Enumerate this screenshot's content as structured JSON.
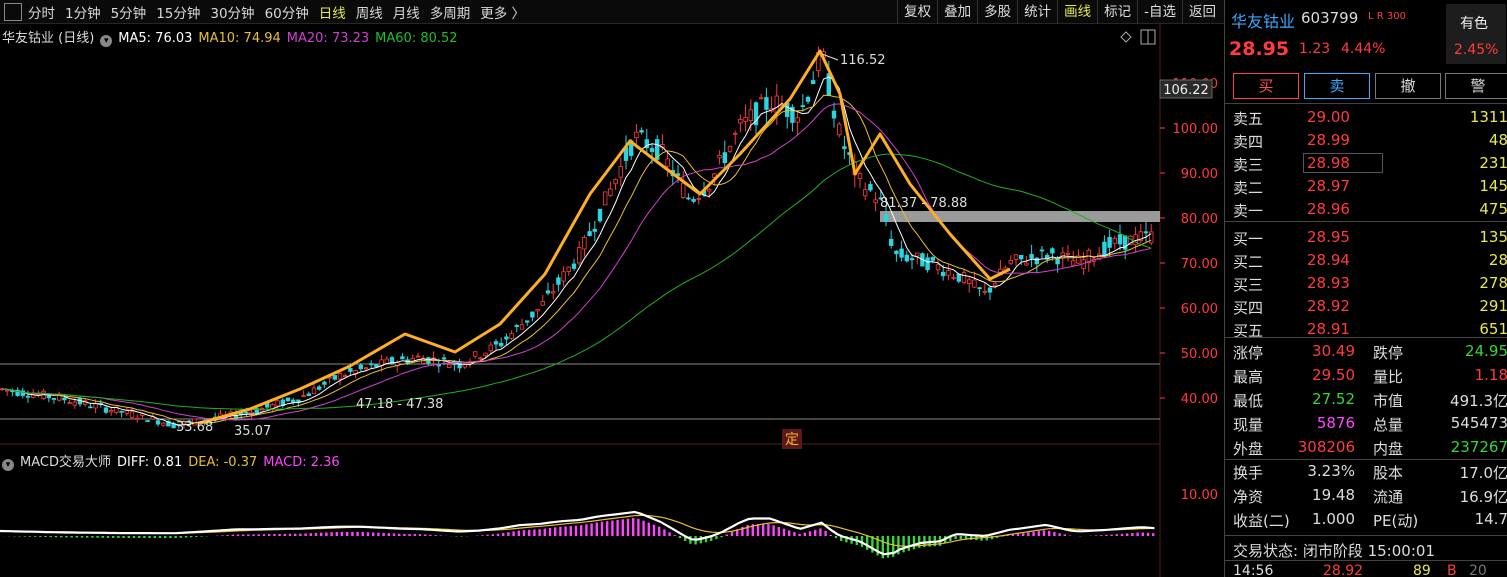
{
  "toolbar": {
    "periods": [
      "分时",
      "1分钟",
      "5分钟",
      "15分钟",
      "30分钟",
      "60分钟",
      "日线",
      "周线",
      "月线",
      "多周期",
      "更多 〉"
    ],
    "active_period": "日线",
    "tools": [
      "复权",
      "叠加",
      "多股",
      "统计",
      "画线",
      "标记",
      "-自选",
      "返回"
    ],
    "active_tool": "画线"
  },
  "legend_main": {
    "title": "华友钴业 (日线)",
    "ma5": "MA5: 76.03",
    "ma10": "MA10: 74.94",
    "ma20": "MA20: 73.23",
    "ma60": "MA60: 80.52"
  },
  "legend_macd": {
    "title": "MACD交易大师",
    "diff": "DIFF: 0.81",
    "dea": "DEA: -0.37",
    "macd": "MACD: 2.36"
  },
  "colors": {
    "up": "#ff3b3b",
    "down": "#2ad4e0",
    "ma5": "#ffffff",
    "ma10": "#e8c030",
    "ma20": "#d040d0",
    "ma60": "#20b020",
    "drawing": "#ffb020"
  },
  "chart_data": {
    "type": "candlestick",
    "y_ticks": [
      "110.00",
      "100.00",
      "90.00",
      "80.00",
      "70.00",
      "60.00",
      "50.00",
      "40.00"
    ],
    "macd_ticks": [
      "10.00"
    ],
    "price_flag": "106.22",
    "annotations": {
      "high": "116.52",
      "low": "33.68",
      "low2": "35.07",
      "range1": "47.18 - 47.38",
      "range2": "81.37 - 78.88"
    },
    "marker_label": "定",
    "ylim": [
      30,
      120
    ]
  },
  "panel": {
    "name": "华友钴业",
    "code": "603799",
    "lr": "L R 300",
    "price": "28.95",
    "change": "1.23",
    "change_pct": "4.44%",
    "sector_name": "有色",
    "sector_chg": "2.45%",
    "buttons": {
      "buy": "买",
      "sell": "卖",
      "cancel": "撤",
      "alert": "警"
    },
    "asks": [
      {
        "label": "卖五",
        "price": "29.00",
        "vol": "1311"
      },
      {
        "label": "卖四",
        "price": "28.99",
        "vol": "48"
      },
      {
        "label": "卖三",
        "price": "28.98",
        "vol": "231"
      },
      {
        "label": "卖二",
        "price": "28.97",
        "vol": "145"
      },
      {
        "label": "卖一",
        "price": "28.96",
        "vol": "475"
      }
    ],
    "bids": [
      {
        "label": "买一",
        "price": "28.95",
        "vol": "135"
      },
      {
        "label": "买二",
        "price": "28.94",
        "vol": "28"
      },
      {
        "label": "买三",
        "price": "28.93",
        "vol": "278"
      },
      {
        "label": "买四",
        "price": "28.92",
        "vol": "291"
      },
      {
        "label": "买五",
        "price": "28.91",
        "vol": "651"
      }
    ],
    "stats1": [
      {
        "l1": "涨停",
        "v1": "30.49",
        "c1": "red",
        "l2": "跌停",
        "v2": "24.95",
        "c2": "green"
      },
      {
        "l1": "最高",
        "v1": "29.50",
        "c1": "red",
        "l2": "量比",
        "v2": "1.18",
        "c2": "red"
      },
      {
        "l1": "最低",
        "v1": "27.52",
        "c1": "green",
        "l2": "市值",
        "v2": "491.3亿",
        "c2": "wht"
      },
      {
        "l1": "现量",
        "v1": "5876",
        "c1": "mag",
        "l2": "总量",
        "v2": "545473",
        "c2": "wht"
      },
      {
        "l1": "外盘",
        "v1": "308206",
        "c1": "red",
        "l2": "内盘",
        "v2": "237267",
        "c2": "green"
      }
    ],
    "stats2": [
      {
        "l1": "换手",
        "v1": "3.23%",
        "c1": "wht",
        "l2": "股本",
        "v2": "17.0亿",
        "c2": "wht"
      },
      {
        "l1": "净资",
        "v1": "19.48",
        "c1": "wht",
        "l2": "流通",
        "v2": "16.9亿",
        "c2": "wht"
      },
      {
        "l1": "收益(二)",
        "v1": "1.000",
        "c1": "wht",
        "l2": "PE(动)",
        "v2": "14.7",
        "c2": "wht"
      }
    ],
    "status": "交易状态: 闭市阶段 15:00:01",
    "tick": {
      "time": "14:56",
      "price": "28.92",
      "vol": "89",
      "bs": "B",
      "n": "20"
    }
  }
}
